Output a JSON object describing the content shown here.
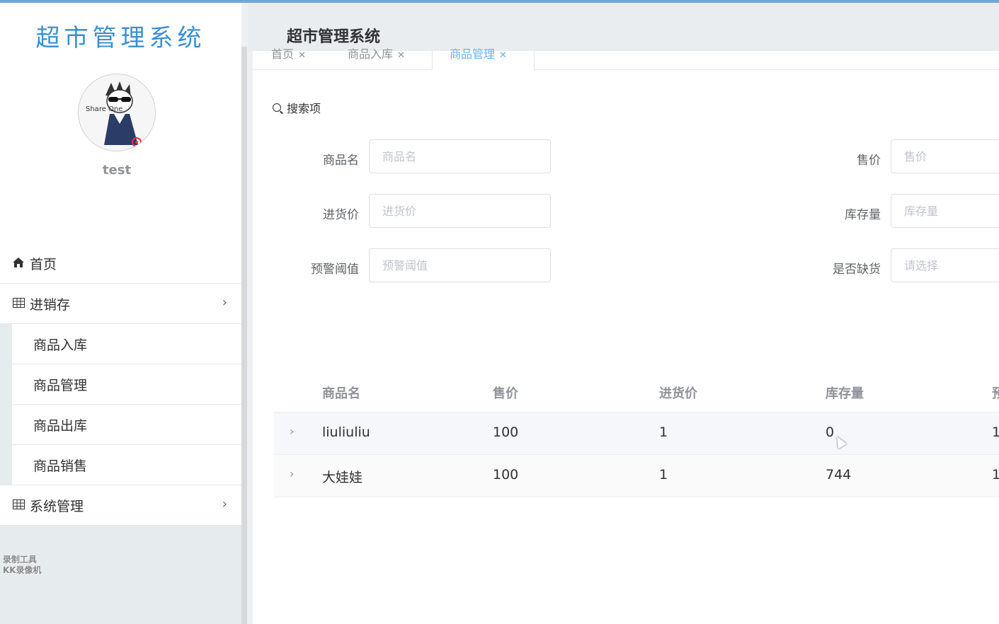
{
  "app": {
    "logo_title": "超市管理系统",
    "header_title": "超市管理系统",
    "username": "test",
    "avatar_text": "Share One",
    "watermark_line1": "录制工具",
    "watermark_line2": "KK录像机"
  },
  "sidebar": {
    "home": {
      "label": "首页",
      "icon": "home-icon"
    },
    "groups": [
      {
        "label": "进销存",
        "icon": "grid-icon",
        "expanded": true,
        "items": [
          "商品入库",
          "商品管理",
          "商品出库",
          "商品销售"
        ]
      },
      {
        "label": "系统管理",
        "icon": "grid-icon",
        "expanded": false
      }
    ]
  },
  "tabs": [
    {
      "label": "首页",
      "active": false
    },
    {
      "label": "商品入库",
      "active": false
    },
    {
      "label": "商品管理",
      "active": true
    }
  ],
  "search": {
    "title": "搜索项",
    "fields": {
      "name": {
        "label": "商品名",
        "placeholder": "商品名",
        "value": ""
      },
      "price": {
        "label": "售价",
        "placeholder": "售价",
        "value": ""
      },
      "cost": {
        "label": "进货价",
        "placeholder": "进货价",
        "value": ""
      },
      "stock": {
        "label": "库存量",
        "placeholder": "库存量",
        "value": ""
      },
      "threshold": {
        "label": "预警阈值",
        "placeholder": "预警阈值",
        "value": ""
      },
      "shortage": {
        "label": "是否缺货",
        "placeholder": "请选择",
        "value": ""
      }
    }
  },
  "table": {
    "headers": [
      "商品名",
      "售价",
      "进货价",
      "库存量",
      "预"
    ],
    "rows": [
      {
        "name": "liuliuliu",
        "price": "100",
        "cost": "1",
        "stock": "0",
        "threshold": "1"
      },
      {
        "name": "大娃娃",
        "price": "100",
        "cost": "1",
        "stock": "744",
        "threshold": "1"
      }
    ]
  },
  "colors": {
    "accent": "#66b1ff",
    "logo": "#3b8fd0",
    "top_bar": "#6ea6de",
    "avatar_badge": "#e0303b"
  }
}
